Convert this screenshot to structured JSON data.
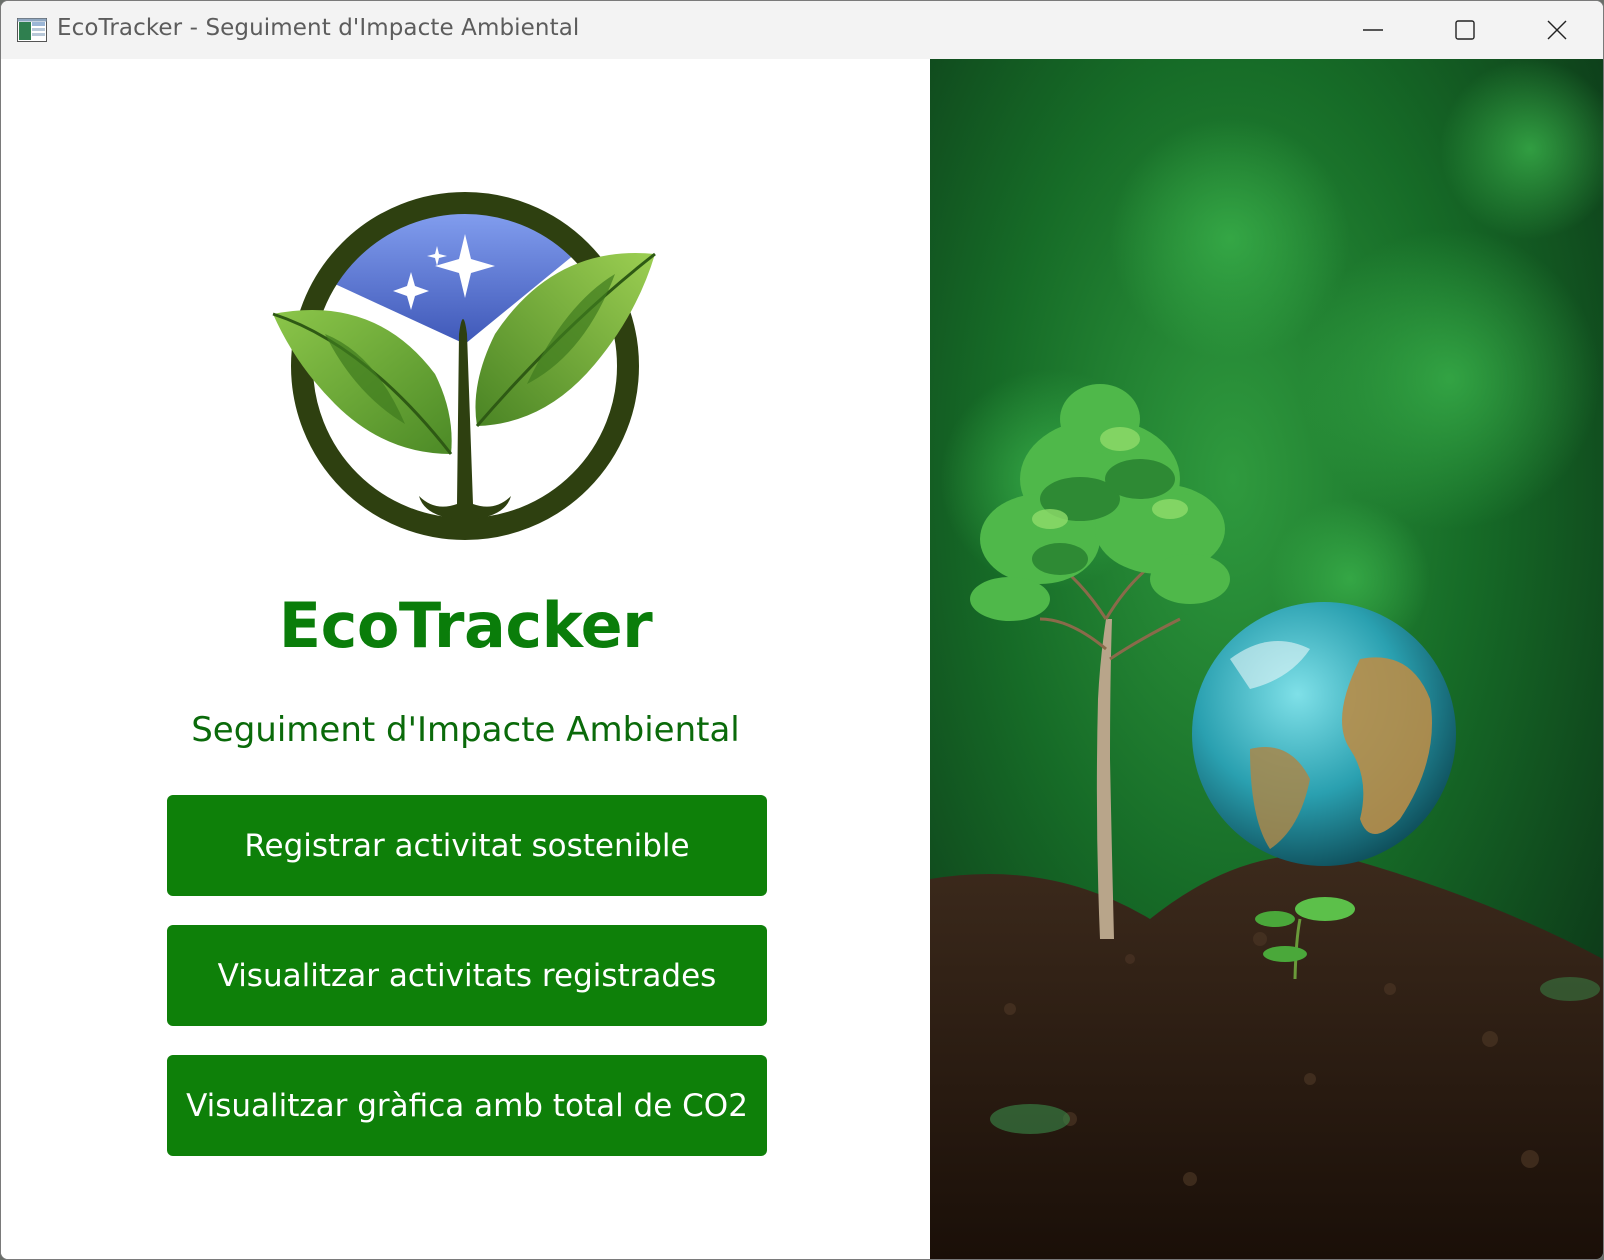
{
  "window": {
    "title": "EcoTracker - Seguiment d'Impacte Ambiental",
    "icon": "app-window-icon",
    "controls": [
      "minimize-icon",
      "maximize-icon",
      "close-icon"
    ]
  },
  "main": {
    "logo_icon": "leaf-sprout-logo-icon",
    "app_name": "EcoTracker",
    "subtitle": "Seguiment d'Impacte Ambiental",
    "buttons": {
      "register": "Registrar activitat sostenible",
      "view_activities": "Visualitzar activitats registrades",
      "view_chart": "Visualitzar gràfica amb total de CO2"
    }
  },
  "image_panel": {
    "subject": "tree-sapling-and-earth-globe-image"
  },
  "colors": {
    "brand_green": "#0a7d0a",
    "button_green": "#0e8009",
    "logo_dark": "#2e4010",
    "logo_sky": "#6a86e6"
  }
}
